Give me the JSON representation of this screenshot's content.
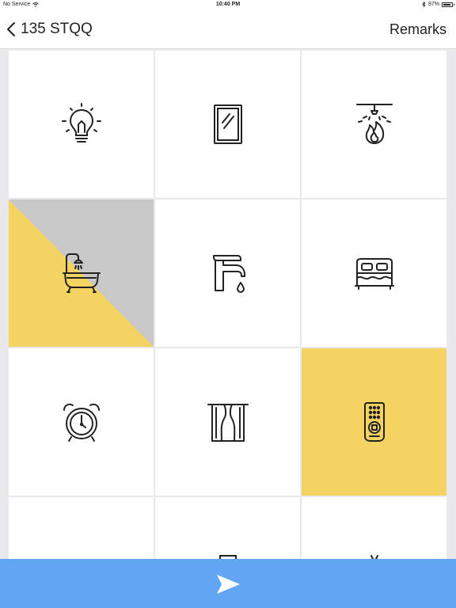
{
  "status_bar": {
    "carrier": "No Service",
    "time": "10:40 PM",
    "battery": "87%"
  },
  "nav": {
    "title": "135 STQQ",
    "remarks_label": "Remarks",
    "back_icon": "chevron-left-icon"
  },
  "tiles": [
    {
      "icon": "light-bulb-icon",
      "state": "unselected"
    },
    {
      "icon": "mirror-icon",
      "state": "unselected"
    },
    {
      "icon": "fire-sprinkler-icon",
      "state": "unselected"
    },
    {
      "icon": "bathtub-shower-icon",
      "state": "partial"
    },
    {
      "icon": "faucet-icon",
      "state": "unselected"
    },
    {
      "icon": "bed-icon",
      "state": "unselected"
    },
    {
      "icon": "alarm-clock-icon",
      "state": "unselected"
    },
    {
      "icon": "curtains-icon",
      "state": "unselected"
    },
    {
      "icon": "remote-control-icon",
      "state": "selected"
    },
    {
      "icon": "unknown-icon",
      "state": "unselected"
    },
    {
      "icon": "unknown-icon",
      "state": "unselected"
    },
    {
      "icon": "unknown-icon",
      "state": "unselected"
    }
  ],
  "submit": {
    "icon": "send-arrow-icon"
  },
  "colors": {
    "selected": "#f4d363",
    "partial_gray": "#c8c8c8",
    "submit_bar": "#62a5f2",
    "background": "#e9e9ed",
    "icon_stroke": "#222222"
  }
}
